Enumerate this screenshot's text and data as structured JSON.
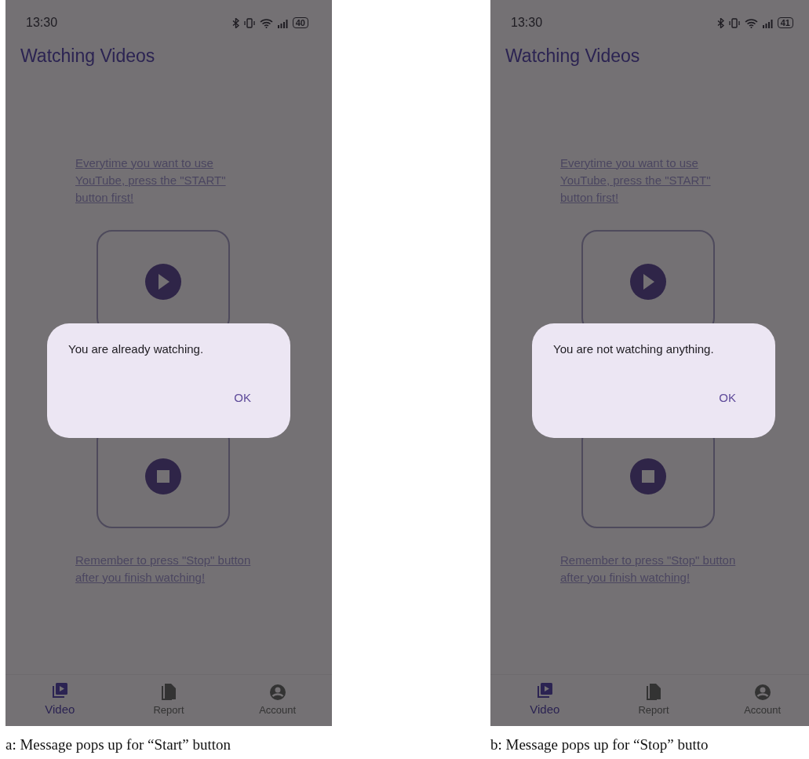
{
  "panels": [
    {
      "status_bar": {
        "time": "13:30",
        "battery": "40"
      },
      "title": "Watching Videos",
      "start_hint": "Everytime you want to use YouTube, press the \"START\" button first!",
      "stop_hint": "Remember to press \"Stop\" button after you finish watching!",
      "dialog": {
        "message": "You are already watching.",
        "button": "OK"
      },
      "nav": [
        {
          "label": "Video",
          "selected": true
        },
        {
          "label": "Report",
          "selected": false
        },
        {
          "label": "Account",
          "selected": false
        }
      ],
      "caption": "a: Message pops up for “Start” button"
    },
    {
      "status_bar": {
        "time": "13:30",
        "battery": "41"
      },
      "title": "Watching Videos",
      "start_hint": "Everytime you want to use YouTube, press the \"START\" button first!",
      "stop_hint": "Remember to press \"Stop\" button after you finish watching!",
      "dialog": {
        "message": "You are not watching anything.",
        "button": "OK"
      },
      "nav": [
        {
          "label": "Video",
          "selected": true
        },
        {
          "label": "Report",
          "selected": false
        },
        {
          "label": "Account",
          "selected": false
        }
      ],
      "caption": "b: Message pops up for “Stop” butto"
    }
  ]
}
